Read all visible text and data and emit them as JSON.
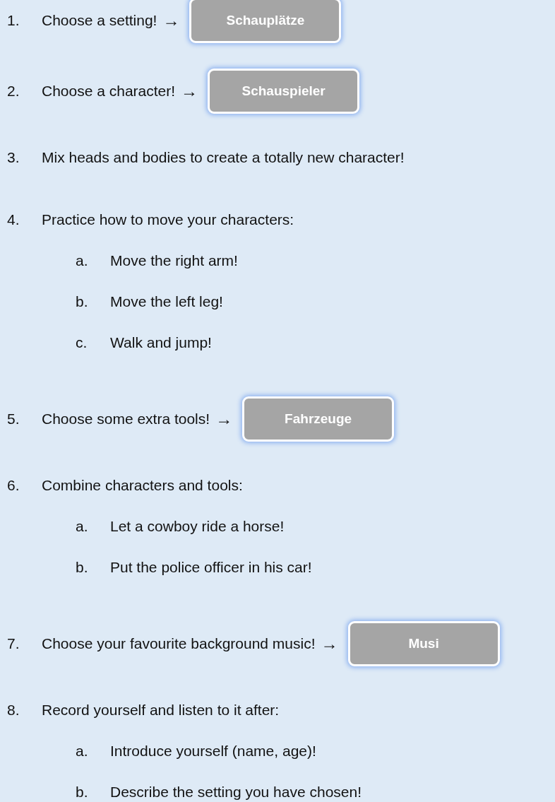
{
  "items": [
    {
      "number": "1.",
      "text": "Choose a setting!",
      "arrow": "→",
      "button": {
        "label": "Schauplätze"
      }
    },
    {
      "number": "2.",
      "text": "Choose a character!",
      "arrow": "→",
      "button": {
        "label": "Schauspieler"
      }
    },
    {
      "number": "3.",
      "text": "Mix heads and bodies to create a totally new character!"
    },
    {
      "number": "4.",
      "text": "Practice how to move your characters:",
      "children": [
        {
          "letter": "a.",
          "text": "Move the right arm!"
        },
        {
          "letter": "b.",
          "text": "Move the left leg!"
        },
        {
          "letter": "c.",
          "text": "Walk and jump!"
        }
      ]
    },
    {
      "number": "5.",
      "text": "Choose some extra tools!",
      "arrow": "→",
      "button": {
        "label": "Fahrzeuge"
      }
    },
    {
      "number": "6.",
      "text": "Combine characters and tools:",
      "children": [
        {
          "letter": "a.",
          "text": "Let a cowboy ride a horse!"
        },
        {
          "letter": "b.",
          "text": "Put the police officer in his car!"
        }
      ]
    },
    {
      "number": "7.",
      "text": "Choose your favourite background music!",
      "arrow": "→",
      "button": {
        "label": "Musi"
      }
    },
    {
      "number": "8.",
      "text": "Record yourself and listen to it after:",
      "children": [
        {
          "letter": "a.",
          "text": "Introduce yourself (name, age)!"
        },
        {
          "letter": "b.",
          "text": "Describe the setting you have chosen!"
        }
      ]
    }
  ]
}
